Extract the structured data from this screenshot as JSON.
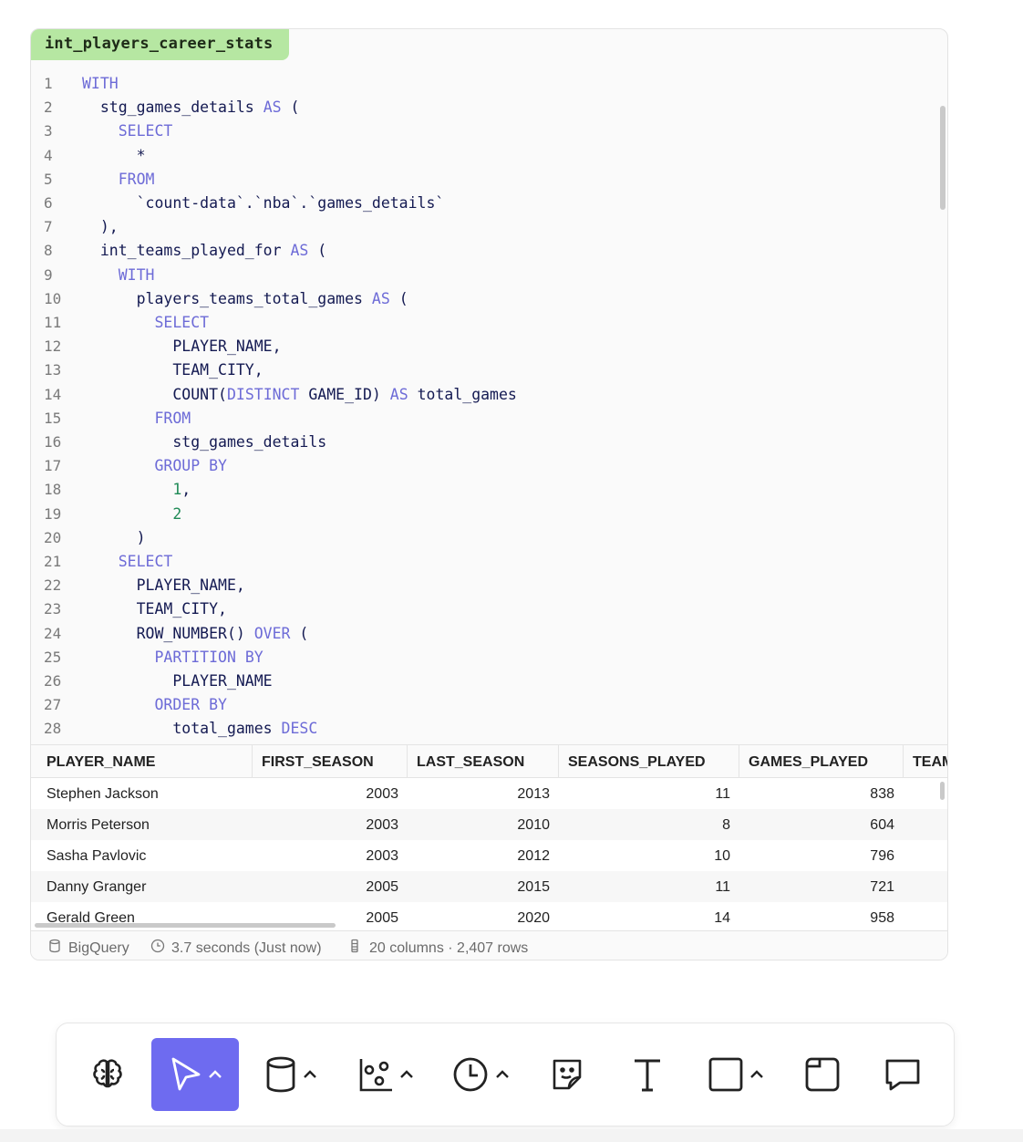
{
  "card": {
    "title": "int_players_career_stats",
    "code_lines": [
      {
        "n": "1",
        "parts": [
          {
            "t": "WITH",
            "k": "kw"
          }
        ]
      },
      {
        "n": "2",
        "parts": [
          {
            "t": "  stg_games_details ",
            "k": ""
          },
          {
            "t": "AS",
            "k": "kw"
          },
          {
            "t": " (",
            "k": ""
          }
        ]
      },
      {
        "n": "3",
        "parts": [
          {
            "t": "    ",
            "k": ""
          },
          {
            "t": "SELECT",
            "k": "kw"
          }
        ]
      },
      {
        "n": "4",
        "parts": [
          {
            "t": "      *",
            "k": ""
          }
        ]
      },
      {
        "n": "5",
        "parts": [
          {
            "t": "    ",
            "k": ""
          },
          {
            "t": "FROM",
            "k": "kw"
          }
        ]
      },
      {
        "n": "6",
        "parts": [
          {
            "t": "      `count-data`.`nba`.`games_details`",
            "k": ""
          }
        ]
      },
      {
        "n": "7",
        "parts": [
          {
            "t": "  ),",
            "k": ""
          }
        ]
      },
      {
        "n": "8",
        "parts": [
          {
            "t": "  int_teams_played_for ",
            "k": ""
          },
          {
            "t": "AS",
            "k": "kw"
          },
          {
            "t": " (",
            "k": ""
          }
        ]
      },
      {
        "n": "9",
        "parts": [
          {
            "t": "    ",
            "k": ""
          },
          {
            "t": "WITH",
            "k": "kw"
          }
        ]
      },
      {
        "n": "10",
        "parts": [
          {
            "t": "      players_teams_total_games ",
            "k": ""
          },
          {
            "t": "AS",
            "k": "kw"
          },
          {
            "t": " (",
            "k": ""
          }
        ]
      },
      {
        "n": "11",
        "parts": [
          {
            "t": "        ",
            "k": ""
          },
          {
            "t": "SELECT",
            "k": "kw"
          }
        ]
      },
      {
        "n": "12",
        "parts": [
          {
            "t": "          PLAYER_NAME,",
            "k": ""
          }
        ]
      },
      {
        "n": "13",
        "parts": [
          {
            "t": "          TEAM_CITY,",
            "k": ""
          }
        ]
      },
      {
        "n": "14",
        "parts": [
          {
            "t": "          COUNT(",
            "k": ""
          },
          {
            "t": "DISTINCT",
            "k": "kw"
          },
          {
            "t": " GAME_ID) ",
            "k": ""
          },
          {
            "t": "AS",
            "k": "kw"
          },
          {
            "t": " total_games",
            "k": ""
          }
        ]
      },
      {
        "n": "15",
        "parts": [
          {
            "t": "        ",
            "k": ""
          },
          {
            "t": "FROM",
            "k": "kw"
          }
        ]
      },
      {
        "n": "16",
        "parts": [
          {
            "t": "          stg_games_details",
            "k": ""
          }
        ]
      },
      {
        "n": "17",
        "parts": [
          {
            "t": "        ",
            "k": ""
          },
          {
            "t": "GROUP BY",
            "k": "kw"
          }
        ]
      },
      {
        "n": "18",
        "parts": [
          {
            "t": "          ",
            "k": ""
          },
          {
            "t": "1",
            "k": "num"
          },
          {
            "t": ",",
            "k": ""
          }
        ]
      },
      {
        "n": "19",
        "parts": [
          {
            "t": "          ",
            "k": ""
          },
          {
            "t": "2",
            "k": "num"
          }
        ]
      },
      {
        "n": "20",
        "parts": [
          {
            "t": "      )",
            "k": ""
          }
        ]
      },
      {
        "n": "21",
        "parts": [
          {
            "t": "    ",
            "k": ""
          },
          {
            "t": "SELECT",
            "k": "kw"
          }
        ]
      },
      {
        "n": "22",
        "parts": [
          {
            "t": "      PLAYER_NAME,",
            "k": ""
          }
        ]
      },
      {
        "n": "23",
        "parts": [
          {
            "t": "      TEAM_CITY,",
            "k": ""
          }
        ]
      },
      {
        "n": "24",
        "parts": [
          {
            "t": "      ROW_NUMBER() ",
            "k": ""
          },
          {
            "t": "OVER",
            "k": "kw"
          },
          {
            "t": " (",
            "k": ""
          }
        ]
      },
      {
        "n": "25",
        "parts": [
          {
            "t": "        ",
            "k": ""
          },
          {
            "t": "PARTITION BY",
            "k": "kw"
          }
        ]
      },
      {
        "n": "26",
        "parts": [
          {
            "t": "          PLAYER_NAME",
            "k": ""
          }
        ]
      },
      {
        "n": "27",
        "parts": [
          {
            "t": "        ",
            "k": ""
          },
          {
            "t": "ORDER BY",
            "k": "kw"
          }
        ]
      },
      {
        "n": "28",
        "parts": [
          {
            "t": "          total_games ",
            "k": ""
          },
          {
            "t": "DESC",
            "k": "kw"
          }
        ]
      }
    ]
  },
  "results": {
    "columns": [
      "PLAYER_NAME",
      "FIRST_SEASON",
      "LAST_SEASON",
      "SEASONS_PLAYED",
      "GAMES_PLAYED",
      "TEAM"
    ],
    "rows": [
      [
        "Stephen Jackson",
        "2003",
        "2013",
        "11",
        "838"
      ],
      [
        "Morris Peterson",
        "2003",
        "2010",
        "8",
        "604"
      ],
      [
        "Sasha Pavlovic",
        "2003",
        "2012",
        "10",
        "796"
      ],
      [
        "Danny Granger",
        "2005",
        "2015",
        "11",
        "721"
      ],
      [
        "Gerald Green",
        "2005",
        "2020",
        "14",
        "958"
      ]
    ]
  },
  "footer": {
    "source": "BigQuery",
    "duration": "3.7 seconds (Just now)",
    "shape": "20 columns · 2,407 rows"
  },
  "toolbar": {
    "tools": [
      {
        "icon": "brain-icon",
        "name": "ai-tool-button"
      },
      {
        "icon": "cursor-icon",
        "name": "select-tool-button",
        "active": true
      },
      {
        "icon": "database-icon",
        "name": "data-tool-button"
      },
      {
        "icon": "chart-icon",
        "name": "chart-tool-button"
      },
      {
        "icon": "clock-icon",
        "name": "schedule-tool-button"
      },
      {
        "icon": "sticky-note-icon",
        "name": "sticky-note-tool-button"
      },
      {
        "icon": "text-icon",
        "name": "text-tool-button"
      },
      {
        "icon": "rectangle-icon",
        "name": "shape-tool-button"
      },
      {
        "icon": "frame-icon",
        "name": "frame-tool-button"
      },
      {
        "icon": "comment-icon",
        "name": "comment-tool-button"
      }
    ],
    "accent": "#6e6bf0"
  }
}
